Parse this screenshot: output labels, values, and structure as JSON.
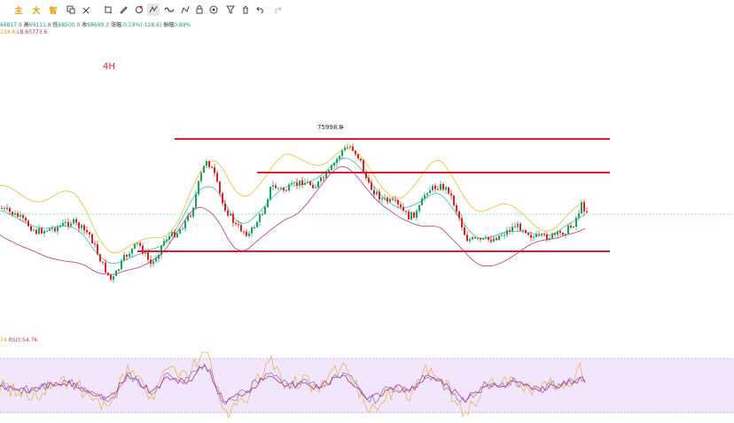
{
  "toolbar": {
    "text_buttons": [
      "主",
      "大",
      "智"
    ],
    "icons": [
      "crosshair-icon",
      "pencil-icon",
      "pin-icon",
      "pattern-icon",
      "curve-icon",
      "path-icon",
      "lock-icon",
      "eye-off-icon",
      "trash-icon",
      "target-icon",
      "filter-icon",
      "undo-icon",
      "redo-icon"
    ]
  },
  "ohlc": {
    "open": "68817.9",
    "high_label": "高",
    "high": "69111.8",
    "low_label": "低",
    "low": "68500.0",
    "close_label": "收",
    "close": "68699.3",
    "change_label": "涨幅",
    "change": "-0.19%(-128.6)",
    "amplitude_label": "振幅",
    "amplitude": "0.89%"
  },
  "bollinger": {
    "mid": "134.8",
    "lb_label": "LB:",
    "lb": "65773.6"
  },
  "timeframe": "4H",
  "annotation": {
    "high_price": "75998.9"
  },
  "rsi": {
    "prefix": "74",
    "label": "RSI3:",
    "value": "54.76"
  },
  "colors": {
    "up": "#1aa260",
    "down": "#e02020",
    "level_line": "#d91f2b",
    "bb_upper": "#e8c020",
    "bb_mid": "#2ec4a0",
    "bb_lower": "#c0337d",
    "rsi_bg": "#f1e6fb"
  }
}
